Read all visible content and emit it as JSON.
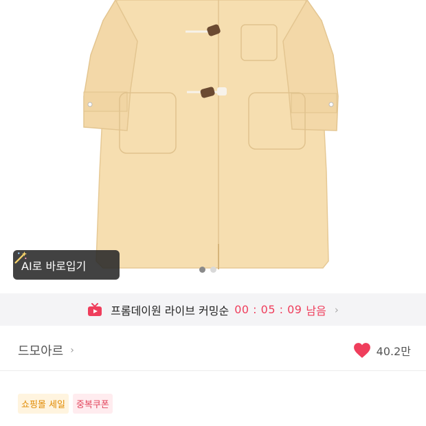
{
  "product_image": {
    "alt_semantic": "cream duffle coat product photo"
  },
  "ai_button": {
    "label": "AI로 바로입기",
    "icon": "magic-wand-icon"
  },
  "carousel": {
    "total": 2,
    "active_index": 0
  },
  "live_banner": {
    "icon": "tv-live-icon",
    "text": "프롬데이원 라이브 커밍순",
    "countdown": "00 : 05 : 09",
    "remain_label": "남음",
    "chevron": "›"
  },
  "store": {
    "name": "드모아르",
    "chevron": "›",
    "likes": "40.2만",
    "heart_icon": "heart-icon"
  },
  "tags": [
    {
      "label": "쇼핑몰 세일"
    },
    {
      "label": "중복쿠폰"
    }
  ],
  "colors": {
    "accent": "#ef3e5c",
    "coat": "#f6deb0",
    "sale_tag": "#e08a00"
  }
}
